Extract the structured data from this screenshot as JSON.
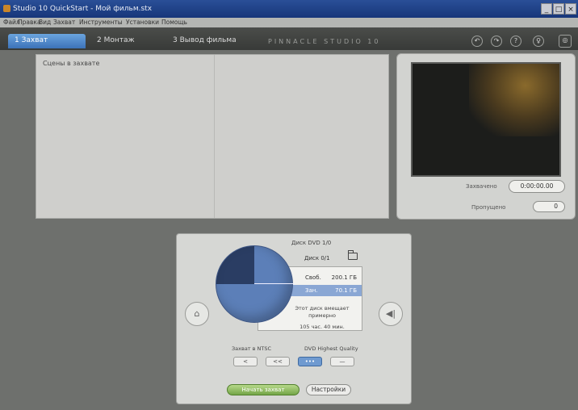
{
  "window": {
    "title": "Studio 10 QuickStart - Мой фильм.stx",
    "buttons": [
      "_",
      "□",
      "×"
    ]
  },
  "menu": [
    "Файл",
    "Правка",
    "Вид",
    "Захват",
    "Инструменты",
    "Установки",
    "Помощь"
  ],
  "tabs": [
    {
      "label": "1 Захват"
    },
    {
      "label": "2 Монтаж"
    },
    {
      "label": "3 Вывод фильма"
    }
  ],
  "brand": "PINNACLE STUDIO 10",
  "toolbar_icons": [
    "undo-icon",
    "redo-icon",
    "help-icon",
    "bulb-icon",
    "disc-icon"
  ],
  "album": {
    "caption": "Сцены в захвате"
  },
  "player": {
    "timecode_label": "Захвачено",
    "timecode": "0:00:00.00",
    "counter_label": "Пропущено",
    "counter": "0"
  },
  "disc": {
    "type": "Диск DVD 1/0",
    "label": "Диск 0/1",
    "free_label": "Своб.",
    "free_value": "200.1 ГБ",
    "used_label": "Зан.",
    "used_value": "70.1 ГБ",
    "note": "Этот диск вмещает примерно",
    "remaining": "105 час. 40 мин.",
    "standard_label": "Захват в NTSC",
    "quality_label": "DVD Highest Quality",
    "quality_buttons": [
      "<",
      "<<",
      "•••",
      "—"
    ],
    "burn_label": "Начать захват",
    "settings_label": "Настройки"
  }
}
